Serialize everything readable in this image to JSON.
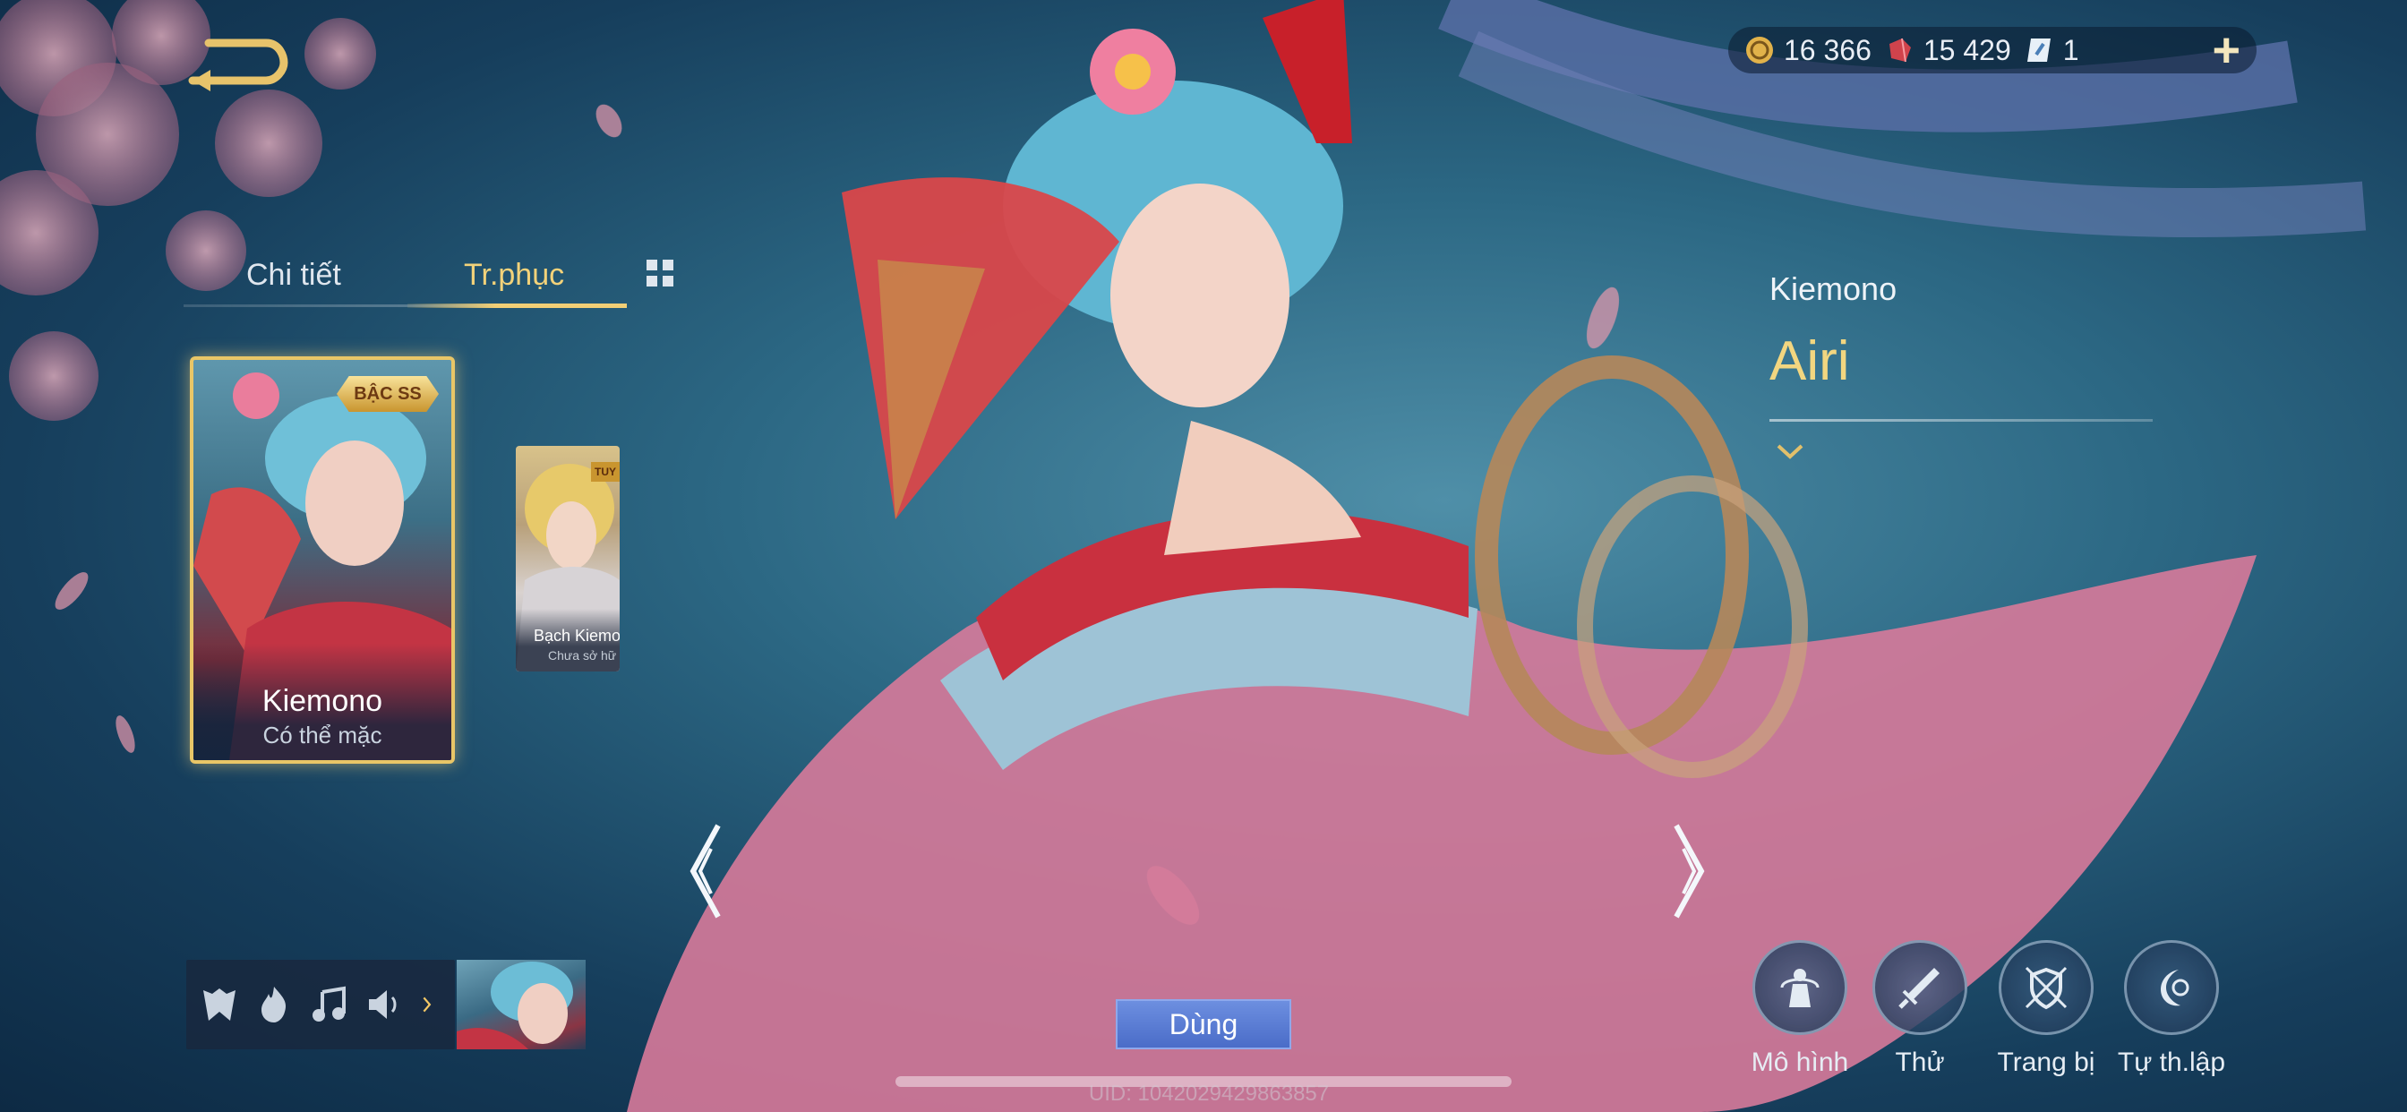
{
  "currency": {
    "gold": "16 366",
    "vouchers": "15 429",
    "tickets": "1"
  },
  "tabs": {
    "details": "Chi tiết",
    "costume": "Tr.phục"
  },
  "skin_cards": [
    {
      "name": "Kiemono",
      "status": "Có thể mặc",
      "badge": "BẬC SS"
    },
    {
      "name": "Bạch Kiemo",
      "status": "Chưa sở hữ",
      "badge": "TUY"
    }
  ],
  "hero": {
    "skin_name": "Kiemono",
    "hero_name": "Airi"
  },
  "equip_button": "Dùng",
  "uid": "UID: 1042029429863857",
  "actions": [
    {
      "label": "Mô hình",
      "icon": "model-icon"
    },
    {
      "label": "Thử",
      "icon": "sword-icon"
    },
    {
      "label": "Trang bị",
      "icon": "shield-swords-icon"
    },
    {
      "label": "Tự th.lập",
      "icon": "moon-icon"
    }
  ],
  "colors": {
    "accent_gold": "#f2d27a",
    "equip_blue": "#5a7bd4"
  }
}
